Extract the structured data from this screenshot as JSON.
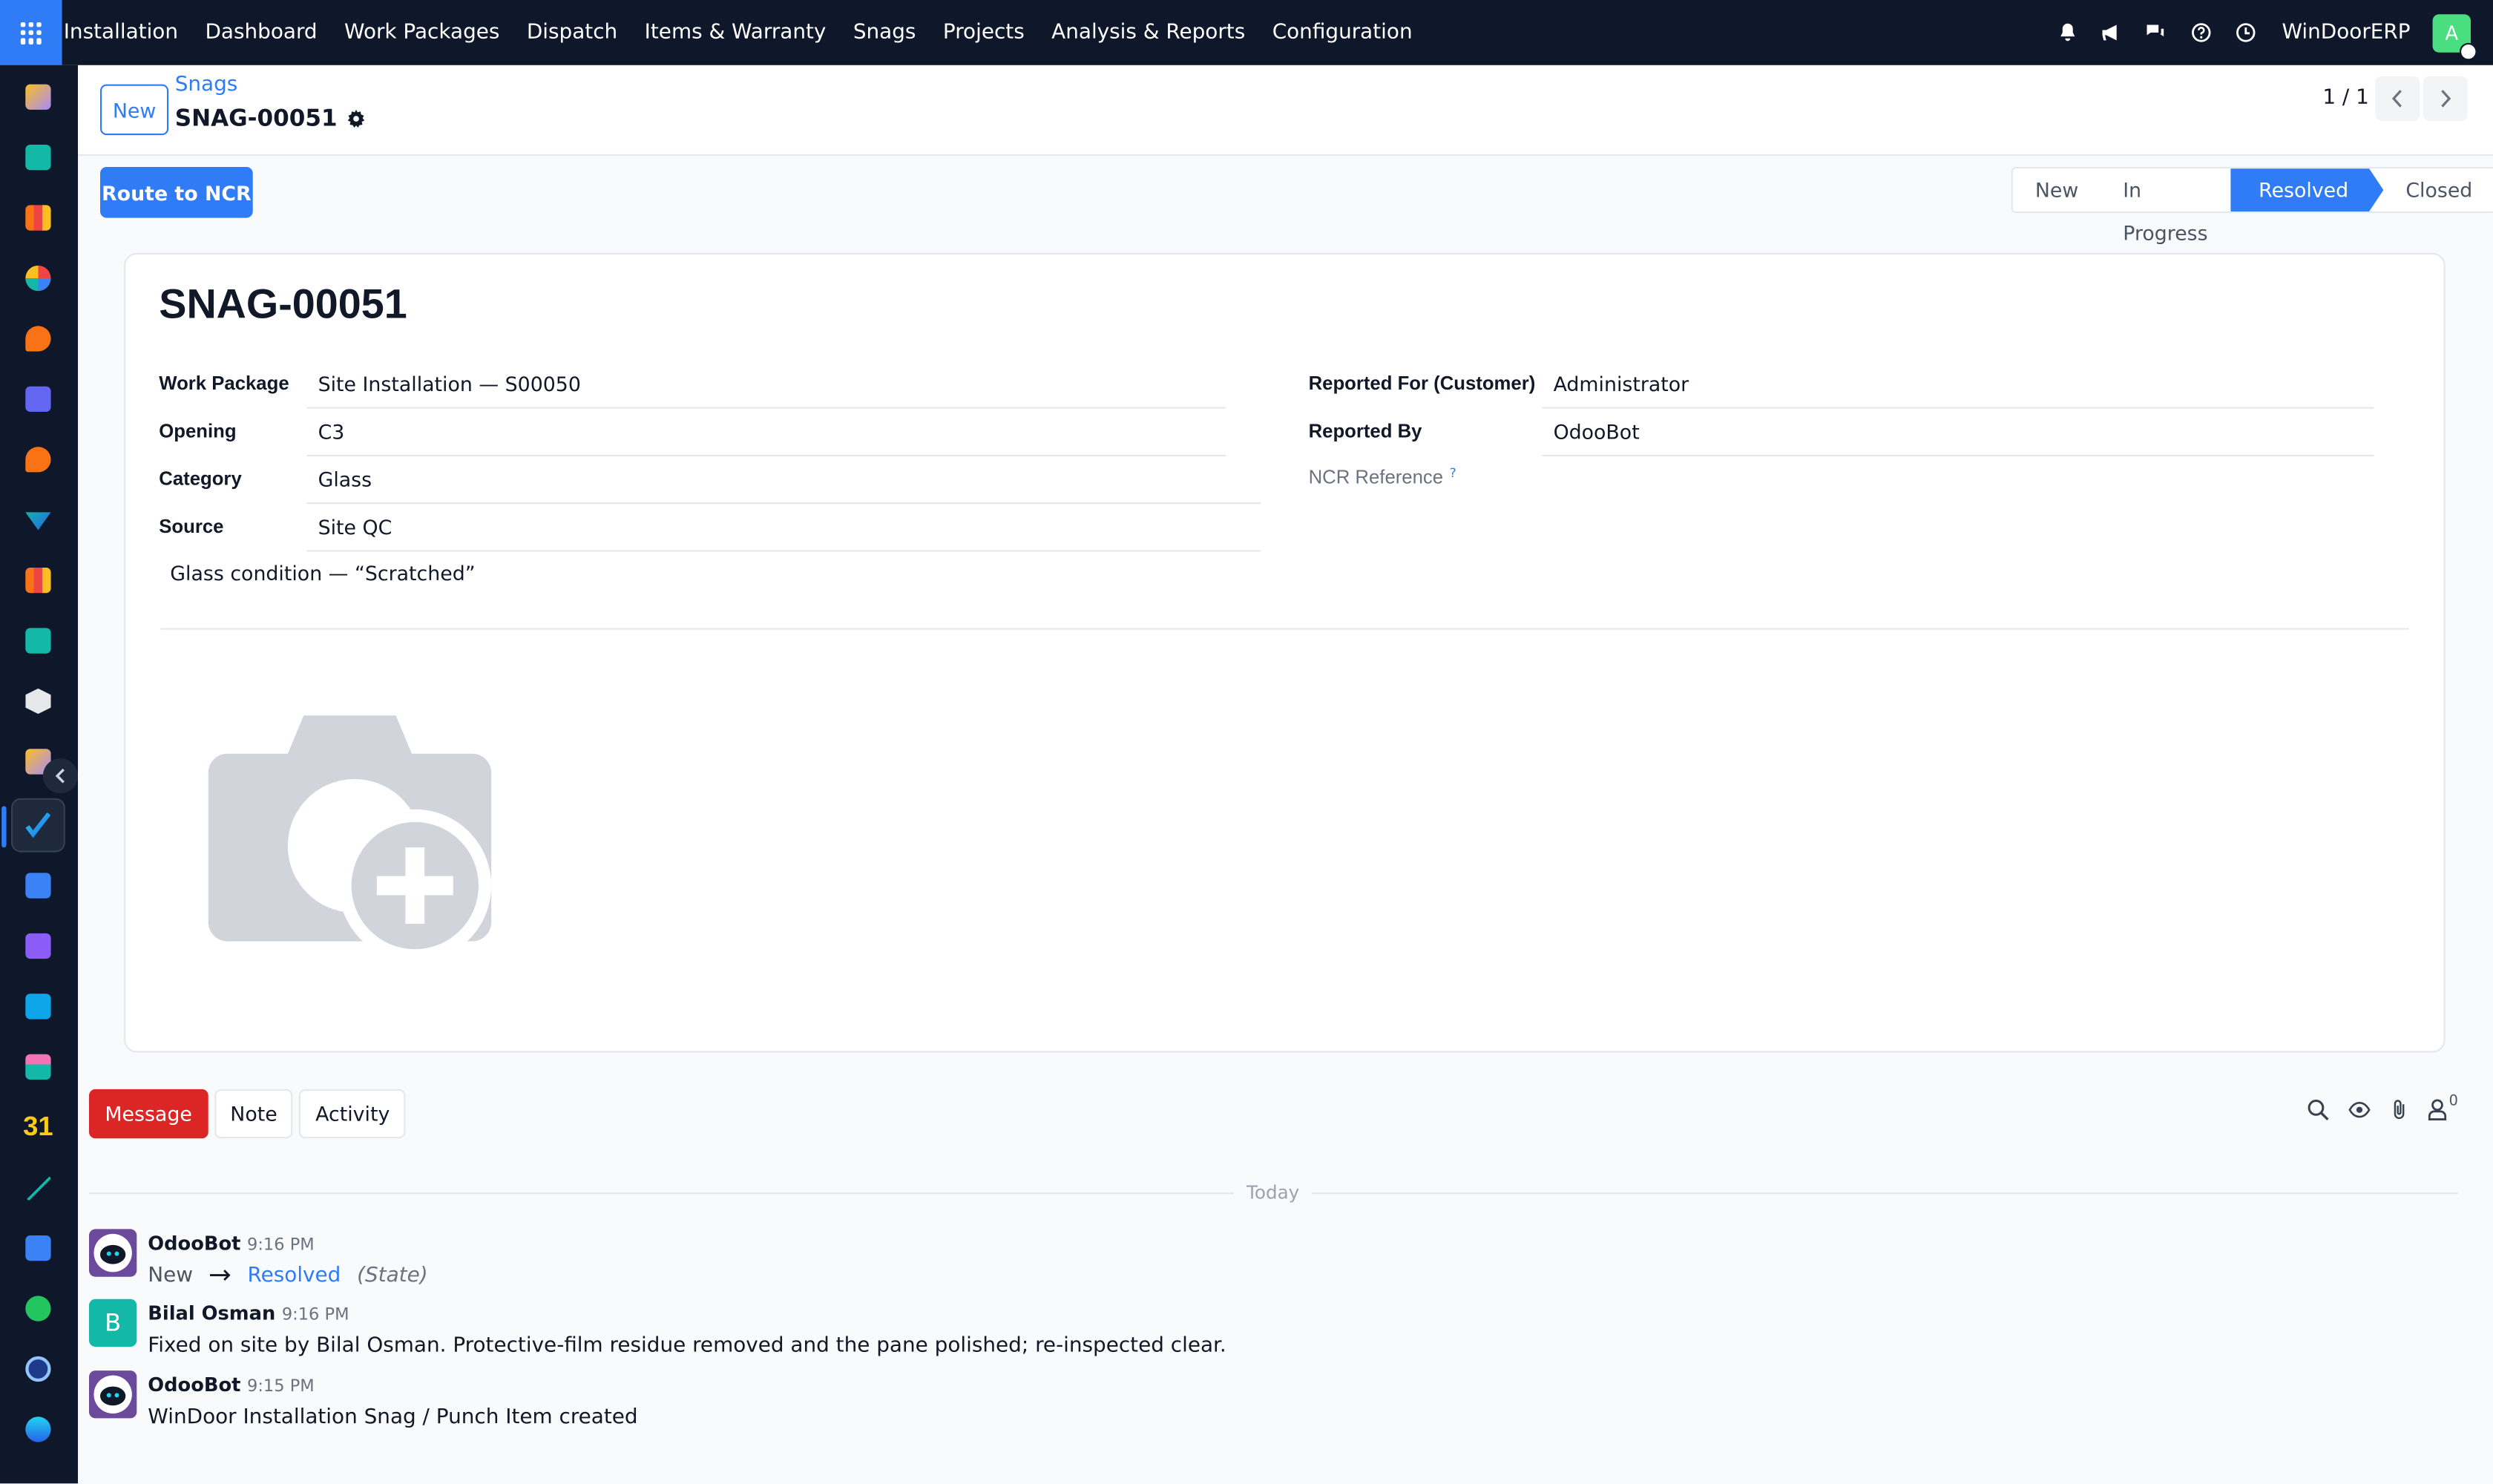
{
  "topbar": {
    "menu": [
      "Installation",
      "Dashboard",
      "Work Packages",
      "Dispatch",
      "Items & Warranty",
      "Snags",
      "Projects",
      "Analysis & Reports",
      "Configuration"
    ],
    "company": "WinDoorERP",
    "avatar_letter": "A",
    "icons": [
      "bell-icon",
      "megaphone-icon",
      "chat-icon",
      "help-icon",
      "clock-icon"
    ]
  },
  "control": {
    "new_label": "New",
    "breadcrumb": "Snags",
    "record_title": "SNAG-00051",
    "pager": "1 / 1"
  },
  "actions": {
    "route_label": "Route to NCR"
  },
  "statusbar": {
    "stages": [
      "New",
      "In Progress",
      "Resolved",
      "Closed"
    ],
    "current": "Resolved"
  },
  "sheet": {
    "title": "SNAG-00051",
    "left_fields": [
      {
        "label": "Work Package",
        "value": "Site Installation — S00050"
      },
      {
        "label": "Opening",
        "value": "C3"
      },
      {
        "label": "Category",
        "value": "Glass"
      },
      {
        "label": "Source",
        "value": "Site QC"
      }
    ],
    "right_fields": [
      {
        "label": "Reported For (Customer)",
        "value": "Administrator"
      },
      {
        "label": "Reported By",
        "value": "OdooBot"
      },
      {
        "label": "NCR Reference",
        "value": ""
      }
    ],
    "help_mark": "?",
    "note": "Glass condition — “Scratched”"
  },
  "chatter": {
    "buttons": [
      "Message",
      "Note",
      "Activity"
    ],
    "follower_count": "0",
    "today_label": "Today",
    "messages": [
      {
        "author": "OdooBot",
        "time": "9:16 PM",
        "from_state": "New",
        "to_state": "Resolved",
        "field": "(State)"
      },
      {
        "author": "Bilal Osman",
        "initial": "B",
        "time": "9:16 PM",
        "body": "Fixed on site by Bilal Osman. Protective-film residue removed and the pane polished; re-inspected clear."
      },
      {
        "author": "OdooBot",
        "time": "9:15 PM",
        "body": "WinDoor Installation Snag / Punch Item created"
      }
    ]
  },
  "colors": {
    "topbar": "#0f172a",
    "primary": "#2f7cf6",
    "message_button": "#dc2626",
    "avatar": "#4ade80",
    "bilal_avatar": "#14b8a6"
  }
}
